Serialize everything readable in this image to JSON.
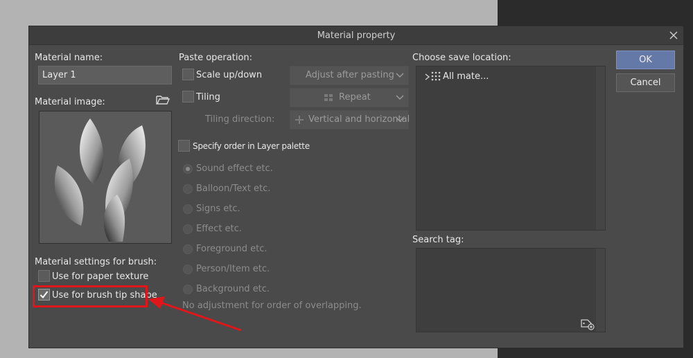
{
  "dialog": {
    "title": "Material property",
    "ok_label": "OK",
    "cancel_label": "Cancel"
  },
  "left": {
    "material_name_label": "Material name:",
    "material_name_value": "Layer 1",
    "material_image_label": "Material image:",
    "brush_settings_label": "Material settings for brush:",
    "paper_texture_label": "Use for paper texture",
    "paper_texture_checked": false,
    "brush_tip_label": "Use for brush tip shape",
    "brush_tip_checked": true
  },
  "paste": {
    "label": "Paste operation:",
    "scale_label": "Scale up/down",
    "scale_dropdown": "Adjust after pasting",
    "tiling_label": "Tiling",
    "tiling_dropdown": "Repeat",
    "tiling_direction_label": "Tiling direction:",
    "tiling_direction_dropdown": "Vertical and horizontal",
    "specify_order_label": "Specify order in Layer palette",
    "radio_options": [
      "Sound effect etc.",
      "Balloon/Text etc.",
      "Signs etc.",
      "Effect etc.",
      "Foreground etc.",
      "Person/Item etc.",
      "Background etc."
    ],
    "no_adjust_label": "No adjustment for order of overlapping."
  },
  "right": {
    "save_location_label": "Choose save location:",
    "tree_item": "All mate...",
    "search_tag_label": "Search tag:"
  },
  "colors": {
    "dialog_bg": "#4a4a4a",
    "primary_button": "#6579a8",
    "annotation": "#e0161a"
  }
}
